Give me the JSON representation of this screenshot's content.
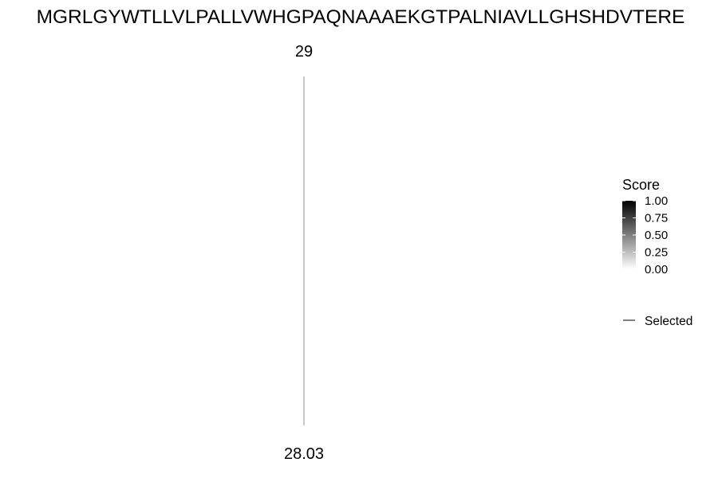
{
  "chart_data": {
    "type": "line",
    "sequence": "MGRLGYWTLLVLPALLVWHGPAQNAAAEKGTPALNIAVLLGHSHDVTERE",
    "top_axis": {
      "label": "29"
    },
    "bottom_axis": {
      "label": "28.03"
    },
    "series": [
      {
        "name": "Selected",
        "from": "29",
        "to": "28.03",
        "color": "#909090"
      }
    ],
    "legend": {
      "title": "Score",
      "placement": "right",
      "scale_min": 0,
      "scale_max": 1,
      "color_low": "#ffffff",
      "color_high": "#000000",
      "ticks": [
        {
          "value": 1.0,
          "label": "1.00"
        },
        {
          "value": 0.75,
          "label": "0.75"
        },
        {
          "value": 0.5,
          "label": "0.50"
        },
        {
          "value": 0.25,
          "label": "0.25"
        },
        {
          "value": 0.0,
          "label": "0.00"
        }
      ],
      "key_label": "Selected"
    }
  }
}
